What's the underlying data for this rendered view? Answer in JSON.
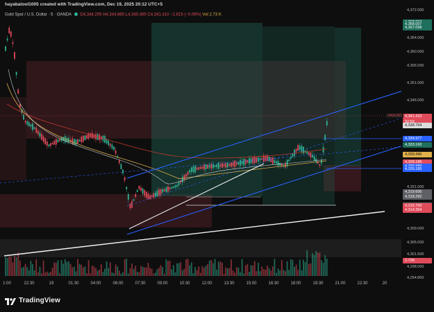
{
  "header": {
    "author_line": "hayabatool1005 created with TradingView.com, Dec 19, 2025 20:12 UTC+5",
    "symbol_name": "Gold Spot / U.S. Dollar · 5 · OANDA",
    "open": "O4,344.205",
    "high": "H4,344.865",
    "low": "L4,340.495",
    "close": "C4,341.410",
    "change": "−2.815 (−0.06%)",
    "volume": "Vol 2.73 K"
  },
  "price_axis": {
    "labels": [
      {
        "text": "4,372.000",
        "value": 4372
      },
      {
        "text": "4,364.000",
        "value": 4364
      },
      {
        "text": "4,360.000",
        "value": 4360
      },
      {
        "text": "4,356.000",
        "value": 4356
      },
      {
        "text": "4,351.000",
        "value": 4351
      },
      {
        "text": "4,346.000",
        "value": 4346
      },
      {
        "text": "4,321.000",
        "value": 4321
      },
      {
        "text": "4,309.000",
        "value": 4309
      },
      {
        "text": "4,305.000",
        "value": 4305
      },
      {
        "text": "4,301.500",
        "value": 4301.5
      },
      {
        "text": "4,298.000",
        "value": 4298
      },
      {
        "text": "4,294.800",
        "value": 4294.8
      }
    ],
    "tags": [
      {
        "text": "4,368.693",
        "value": 4368.693,
        "bg": "#1e6f5c",
        "fg": "#ffffff"
      },
      {
        "text": "4,368.007",
        "value": 4368.007,
        "bg": "#1e6f5c",
        "fg": "#ffffff"
      },
      {
        "text": "4,367.058",
        "value": 4367.058,
        "bg": "#1e6f5c",
        "fg": "#ffffff"
      },
      {
        "text": "4,341.410",
        "value": 4341.41,
        "bg": "#e04b5a",
        "fg": "#ffffff"
      },
      {
        "text": "02:59",
        "value": 4339.9,
        "bg": "#e04b5a",
        "fg": "#ffffff"
      },
      {
        "text": "4,338.764",
        "value": 4338.764,
        "bg": "#dcdcdc",
        "fg": "#111111"
      },
      {
        "text": "4,334.977",
        "value": 4334.977,
        "bg": "#2962ff",
        "fg": "#ffffff"
      },
      {
        "text": "4,333.160",
        "value": 4333.16,
        "bg": "#1e6f5c",
        "fg": "#ffffff"
      },
      {
        "text": "4,330.496",
        "value": 4330.496,
        "bg": "#e0b04b",
        "fg": "#111111"
      },
      {
        "text": "4,328.186",
        "value": 4328.186,
        "bg": "#e04b5a",
        "fg": "#ffffff"
      },
      {
        "text": "4,326.989",
        "value": 4326.989,
        "bg": "#2962ff",
        "fg": "#ffffff"
      },
      {
        "text": "4,326.185",
        "value": 4326.185,
        "bg": "#2962ff",
        "fg": "#ffffff"
      },
      {
        "text": "4,319.606",
        "value": 4319.606,
        "bg": "#5e6066",
        "fg": "#ffffff"
      },
      {
        "text": "4,318.292",
        "value": 4318.292,
        "bg": "#5e6066",
        "fg": "#ffffff"
      },
      {
        "text": "4,315.701",
        "value": 4315.701,
        "bg": "#5e6066",
        "fg": "#ffffff"
      },
      {
        "text": "4,315.700",
        "value": 4315.7,
        "bg": "#e04b5a",
        "fg": "#ffffff"
      },
      {
        "text": "4,314.354",
        "value": 4314.354,
        "bg": "#e04b5a",
        "fg": "#ffffff"
      },
      {
        "text": "2.73K",
        "value": 4299.9,
        "bg": "#e04b5a",
        "fg": "#ffffff"
      }
    ]
  },
  "symbol_tag": "XAUUSD",
  "time_axis": [
    "1:00",
    "22:30",
    "19",
    "01:30",
    "04:00",
    "06:00",
    "07:30",
    "09:00",
    "10:30",
    "12:00",
    "13:30",
    "15:00",
    "16:30",
    "18:00",
    "19:30",
    "21:00",
    "22:30",
    "20"
  ],
  "brand": {
    "name": "TradingView"
  },
  "colors": {
    "up": "#2fb394",
    "down": "#e04b5a",
    "channel": "#2962ff",
    "background": "#0e0e0e"
  }
}
